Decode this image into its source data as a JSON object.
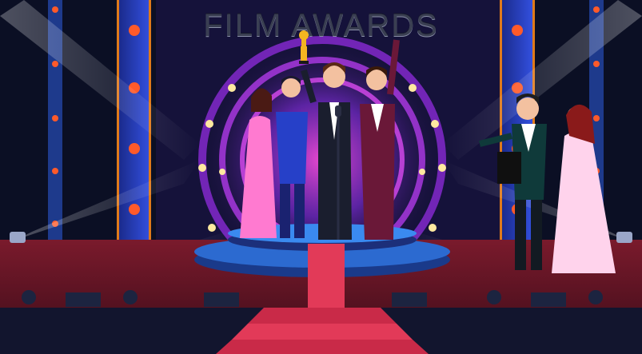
{
  "title": "FILM AWARDS",
  "colors": {
    "background": "#0a0d1e",
    "stage_floor": "#6b1424",
    "carpet": "#e23a58",
    "ring_glow": "#a42bd6",
    "lights": "#ffe9a0"
  }
}
